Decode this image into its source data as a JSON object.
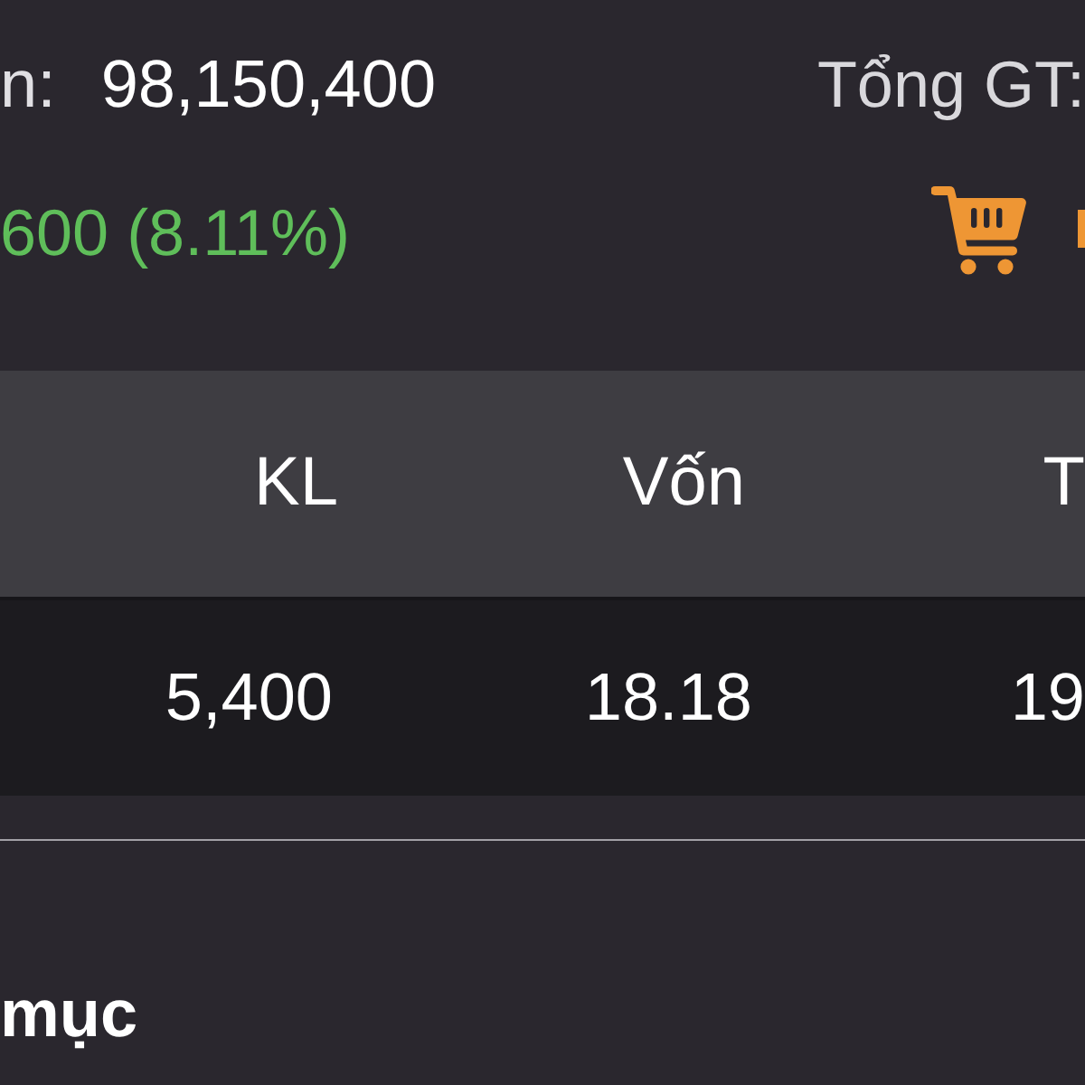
{
  "summary": {
    "label": "n:",
    "value": "98,150,400",
    "total_label": "Tổng GT:",
    "change": "600 (8.11%)",
    "gain": true
  },
  "table": {
    "columns": [
      "KL",
      "Vốn",
      "T"
    ],
    "rows": [
      [
        "5,400",
        "18.18",
        "19"
      ]
    ]
  },
  "section_title": "mục"
}
